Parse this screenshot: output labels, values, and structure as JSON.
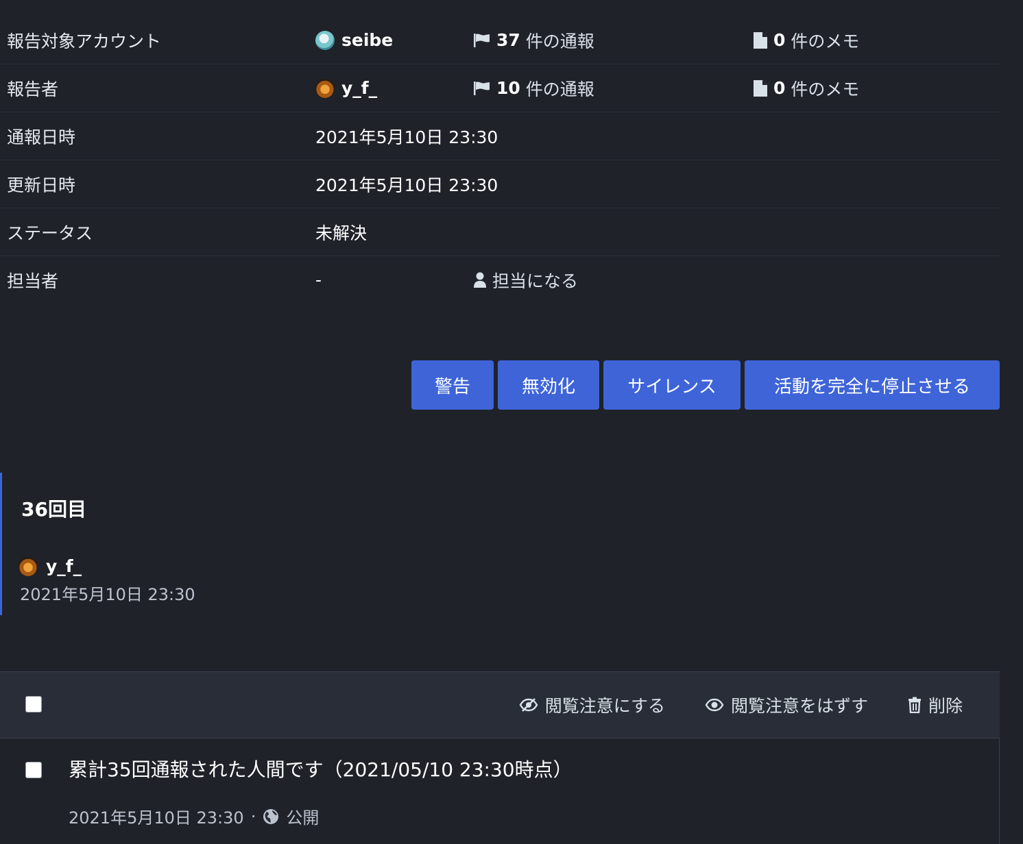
{
  "info": {
    "target": {
      "label": "報告対象アカウント",
      "username": "seibe",
      "reports_count": "37",
      "reports_suffix": "件の通報",
      "memos_count": "0",
      "memos_suffix": "件のメモ"
    },
    "reporter": {
      "label": "報告者",
      "username": "y_f_",
      "reports_count": "10",
      "reports_suffix": "件の通報",
      "memos_count": "0",
      "memos_suffix": "件のメモ"
    },
    "reported_at": {
      "label": "通報日時",
      "value": "2021年5月10日 23:30"
    },
    "updated_at": {
      "label": "更新日時",
      "value": "2021年5月10日 23:30"
    },
    "status": {
      "label": "ステータス",
      "value": "未解決"
    },
    "assignee": {
      "label": "担当者",
      "value": "-",
      "assign_action": "担当になる"
    }
  },
  "actions": {
    "warn": "警告",
    "disable": "無効化",
    "silence": "サイレンス",
    "suspend": "活動を完全に停止させる"
  },
  "report": {
    "title": "36回目",
    "username": "y_f_",
    "time": "2021年5月10日 23:30"
  },
  "toolbar": {
    "mark_sensitive": "閲覧注意にする",
    "unmark_sensitive": "閲覧注意をはずす",
    "delete": "削除"
  },
  "status_item": {
    "text": "累計35回通報された人間です（2021/05/10 23:30時点）",
    "time": "2021年5月10日 23:30",
    "separator": "·",
    "visibility": "公開"
  },
  "colors": {
    "background": "#1f2229",
    "accent": "#3e64d8",
    "toolbar": "#292d37"
  }
}
